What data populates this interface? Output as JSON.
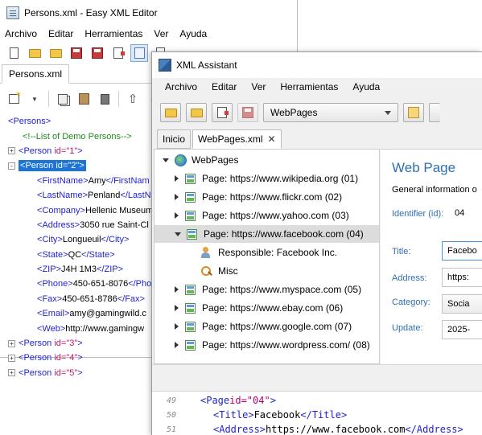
{
  "back_window": {
    "title": "Persons.xml - Easy XML Editor",
    "menu": [
      "Archivo",
      "Editar",
      "Herramientas",
      "Ver",
      "Ayuda"
    ],
    "tab": "Persons.xml",
    "tree": [
      {
        "indent": 0,
        "expander": "",
        "open": "<",
        "tag": "Persons",
        "close": ">"
      },
      {
        "indent": 1,
        "expander": "",
        "comment": "<!--List of Demo Persons-->"
      },
      {
        "indent": 0,
        "expander": "+",
        "open": "<",
        "tag": "Person",
        "attr": " id=\"1\"",
        "close": ">"
      },
      {
        "indent": 0,
        "expander": "-",
        "open": "<",
        "tag": "Person",
        "attr": " id=\"2\"",
        "close": ">",
        "selected": true
      },
      {
        "indent": 2,
        "expander": "",
        "open": "<",
        "tag": "FirstName",
        "close": ">",
        "text": "Amy",
        "end": "</FirstNam"
      },
      {
        "indent": 2,
        "expander": "",
        "open": "<",
        "tag": "LastName",
        "close": ">",
        "text": "Penland",
        "end": "</LastNam"
      },
      {
        "indent": 2,
        "expander": "",
        "open": "<",
        "tag": "Company",
        "close": ">",
        "text": "Hellenic Museum",
        "end": ""
      },
      {
        "indent": 2,
        "expander": "",
        "open": "<",
        "tag": "Address",
        "close": ">",
        "text": "3050 rue Saint-Cl",
        "end": ""
      },
      {
        "indent": 2,
        "expander": "",
        "open": "<",
        "tag": "City",
        "close": ">",
        "text": "Longueuil",
        "end": "</City>"
      },
      {
        "indent": 2,
        "expander": "",
        "open": "<",
        "tag": "State",
        "close": ">",
        "text": "QC",
        "end": "</State>"
      },
      {
        "indent": 2,
        "expander": "",
        "open": "<",
        "tag": "ZIP",
        "close": ">",
        "text": "J4H 1M3",
        "end": "</ZIP>"
      },
      {
        "indent": 2,
        "expander": "",
        "open": "<",
        "tag": "Phone",
        "close": ">",
        "text": "450-651-8076",
        "end": "</Pho"
      },
      {
        "indent": 2,
        "expander": "",
        "open": "<",
        "tag": "Fax",
        "close": ">",
        "text": "450-651-8786",
        "end": "</Fax>"
      },
      {
        "indent": 2,
        "expander": "",
        "open": "<",
        "tag": "Email",
        "close": ">",
        "text": "amy@gamingwild.c",
        "end": ""
      },
      {
        "indent": 2,
        "expander": "",
        "open": "<",
        "tag": "Web",
        "close": ">",
        "text": "http://www.gamingw",
        "end": ""
      },
      {
        "indent": 0,
        "expander": "+",
        "open": "<",
        "tag": "Person",
        "attr": " id=\"3\"",
        "close": ">"
      },
      {
        "indent": 0,
        "expander": "+",
        "open": "<",
        "tag": "Person",
        "attr": " id=\"4\"",
        "close": ">"
      },
      {
        "indent": 0,
        "expander": "+",
        "open": "<",
        "tag": "Person",
        "attr": " id=\"5\"",
        "close": ">"
      }
    ]
  },
  "front_window": {
    "title": "XML Assistant",
    "menu": [
      "Archivo",
      "Editar",
      "Ver",
      "Herramientas",
      "Ayuda"
    ],
    "combo_value": "WebPages",
    "tabs": [
      {
        "label": "Inicio",
        "active": false
      },
      {
        "label": "WebPages.xml",
        "active": true,
        "close": "✕"
      }
    ],
    "tree": [
      {
        "level": 0,
        "expander": "down",
        "icon": "globe",
        "label": "WebPages"
      },
      {
        "level": 1,
        "expander": "right",
        "icon": "page",
        "label": "Page: https://www.wikipedia.org (01)"
      },
      {
        "level": 1,
        "expander": "right",
        "icon": "page",
        "label": "Page: https://www.flickr.com (02)"
      },
      {
        "level": 1,
        "expander": "right",
        "icon": "page",
        "label": "Page: https://www.yahoo.com (03)"
      },
      {
        "level": 1,
        "expander": "down",
        "icon": "page",
        "label": "Page: https://www.facebook.com (04)",
        "selected": true
      },
      {
        "level": 2,
        "expander": "",
        "icon": "person",
        "label": "Responsible: Facebook Inc."
      },
      {
        "level": 2,
        "expander": "",
        "icon": "search",
        "label": "Misc"
      },
      {
        "level": 1,
        "expander": "right",
        "icon": "page",
        "label": "Page: https://www.myspace.com (05)"
      },
      {
        "level": 1,
        "expander": "right",
        "icon": "page",
        "label": "Page: https://www.ebay.com (06)"
      },
      {
        "level": 1,
        "expander": "right",
        "icon": "page",
        "label": "Page: https://www.google.com (07)"
      },
      {
        "level": 1,
        "expander": "right",
        "icon": "page",
        "label": "Page: https://www.wordpress.com/ (08)"
      }
    ],
    "detail": {
      "heading": "Web Page",
      "subheading": "General information o",
      "identifier_label": "Identifier (id):",
      "identifier_value": "04",
      "title_label": "Title:",
      "title_value": "Facebo",
      "address_label": "Address:",
      "address_value": "https:",
      "category_label": "Category:",
      "category_value": "Socia",
      "update_label": "Update:",
      "update_value": "2025-"
    },
    "code": [
      {
        "num": "49",
        "indent": 0,
        "parts": [
          {
            "t": "ctag",
            "v": "<Page"
          },
          {
            "t": "cattr",
            "v": " id=\"04\""
          },
          {
            "t": "ctag",
            "v": ">"
          }
        ]
      },
      {
        "num": "50",
        "indent": 1,
        "parts": [
          {
            "t": "ctag",
            "v": "<Title>"
          },
          {
            "t": "ctext",
            "v": "Facebook"
          },
          {
            "t": "ctag",
            "v": "</Title>"
          }
        ]
      },
      {
        "num": "51",
        "indent": 1,
        "parts": [
          {
            "t": "ctag",
            "v": "<Address>"
          },
          {
            "t": "ctext",
            "v": "https://www.facebook.com"
          },
          {
            "t": "ctag",
            "v": "</Address>"
          }
        ]
      }
    ]
  }
}
